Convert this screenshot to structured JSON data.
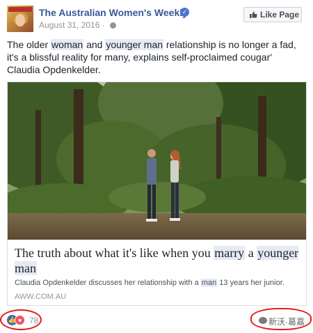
{
  "page": {
    "name": "The Australian Women's Weekly",
    "timestamp": "August 31, 2016 · ",
    "like_button": "Like Page"
  },
  "caption": {
    "t1": "The older ",
    "w1": "woman",
    "t2": " and ",
    "w2": "younger man",
    "t3": " relationship is no longer a fad, it's a blissful reality for many, explains self-proclaimed cougar' Claudia Opdenkelder."
  },
  "link_card": {
    "title_a": "The truth about what it's like when you ",
    "title_hl1": "marry",
    "title_b": " a ",
    "title_hl2": "younger man",
    "desc_a": "Claudia Opdenkelder discusses her relationship with a ",
    "desc_hl": "man",
    "desc_b": " 13 years her junior.",
    "domain": "AWW.COM.AU"
  },
  "reactions": {
    "count": "78",
    "types": [
      "like",
      "love"
    ]
  },
  "watermark": {
    "text": "新沃·葛嘉"
  },
  "colors": {
    "brand_blue": "#365899",
    "like_blue": "#4267b2",
    "love_red": "#f25268",
    "annotation_red": "#e01b1b"
  }
}
